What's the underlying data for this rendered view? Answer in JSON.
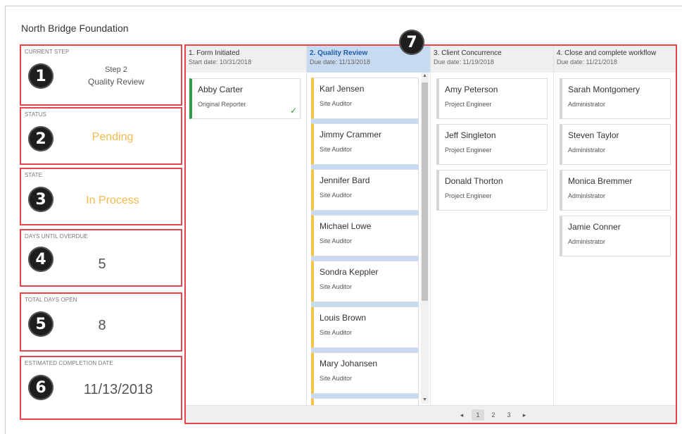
{
  "org_title": "North Bridge Foundation",
  "summary": [
    {
      "label": "CURRENT STEP",
      "badge": "1",
      "line1": "Step 2",
      "line2": "Quality Review"
    },
    {
      "label": "STATUS",
      "badge": "2",
      "value": "Pending",
      "value_color": "#f2b94c"
    },
    {
      "label": "STATE",
      "badge": "3",
      "value": "In Process",
      "value_color": "#f2b94c"
    },
    {
      "label": "DAYS UNTIL OVERDUE",
      "badge": "4",
      "value": "5"
    },
    {
      "label": "TOTAL DAYS OPEN",
      "badge": "5",
      "value": "8"
    },
    {
      "label": "ESTIMATED COMPLETION DATE",
      "badge": "6",
      "value": "11/13/2018"
    }
  ],
  "board": {
    "badge": "7",
    "columns": [
      {
        "name": "1. Form Initiated",
        "date": "Start date:  10/31/2018",
        "active": false,
        "cards": [
          {
            "name": "Abby Carter",
            "role": "Original Reporter",
            "status": "complete"
          }
        ]
      },
      {
        "name": "2. Quality Review",
        "date": "Due date: 11/13/2018",
        "active": true,
        "cards": [
          {
            "name": "Karl Jensen",
            "role": "Site Auditor"
          },
          {
            "name": "Jimmy Crammer",
            "role": "Site Auditor"
          },
          {
            "name": "Jennifer Bard",
            "role": "Site Auditor"
          },
          {
            "name": "Michael Lowe",
            "role": "Site Auditor"
          },
          {
            "name": "Sondra Keppler",
            "role": "Site Auditor"
          },
          {
            "name": "Louis Brown",
            "role": "Site Auditor"
          },
          {
            "name": "Mary Johansen",
            "role": "Site Auditor"
          }
        ]
      },
      {
        "name": "3. Client Concurrence",
        "date": "Due date: 11/19/2018",
        "active": false,
        "cards": [
          {
            "name": "Amy Peterson",
            "role": "Project Engineer"
          },
          {
            "name": "Jeff Singleton",
            "role": "Project Engineer"
          },
          {
            "name": "Donald Thorton",
            "role": "Project Engineer"
          }
        ]
      },
      {
        "name": "4. Close and complete workflow",
        "date": "Due date: 11/21/2018",
        "active": false,
        "cards": [
          {
            "name": "Sarah Montgomery",
            "role": "Administrator"
          },
          {
            "name": "Steven Taylor",
            "role": "Administrator"
          },
          {
            "name": "Monica Bremmer",
            "role": "Administrator"
          },
          {
            "name": "Jamie Conner",
            "role": "Administrator"
          }
        ]
      }
    ],
    "pagination": {
      "prev": "◂",
      "pages": [
        "1",
        "2",
        "3"
      ],
      "current": "1",
      "next": "▸"
    },
    "colors": {
      "accent_blue": "#c6daf2",
      "active_border": "#f3c24a",
      "complete": "#2f9e44",
      "callout": "#e8444b"
    }
  }
}
